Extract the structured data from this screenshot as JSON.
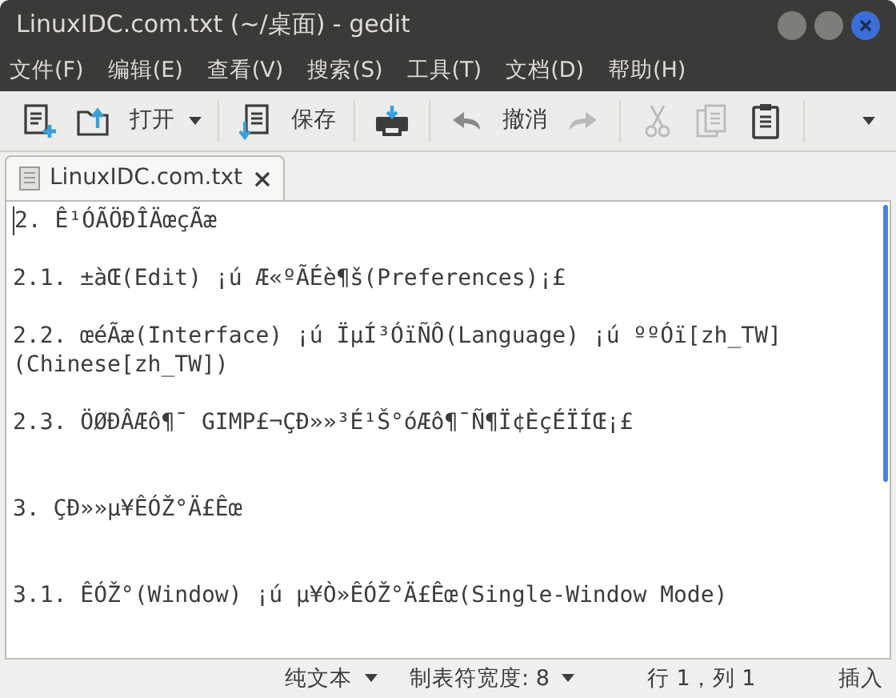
{
  "window": {
    "title": "LinuxIDC.com.txt (~/桌面) - gedit"
  },
  "menu": [
    "文件(F)",
    "编辑(E)",
    "查看(V)",
    "搜索(S)",
    "工具(T)",
    "文档(D)",
    "帮助(H)"
  ],
  "toolbar": [
    {
      "kind": "new"
    },
    {
      "kind": "open",
      "label": "打开"
    },
    {
      "kind": "save",
      "label": "保存"
    },
    {
      "kind": "print"
    },
    {
      "kind": "undo",
      "label": "撤消"
    },
    {
      "kind": "redo",
      "disabled": true
    },
    {
      "kind": "cut",
      "disabled": true
    },
    {
      "kind": "copy",
      "disabled": true
    },
    {
      "kind": "paste"
    },
    {
      "kind": "more"
    }
  ],
  "tabs": [
    {
      "label": "LinuxIDC.com.txt",
      "selected": true
    }
  ],
  "document": {
    "text": "2. Ê¹ÓÃÖÐÎÄœçÃæ\n\n2.1. ±àŒ(Edit) ¡ú Æ«ºÃÉè¶š(Preferences)¡£\n\n2.2. œéÃæ(Interface) ¡ú ÏµÍ³ÓïÑÔ(Language) ¡ú ººÓï[zh_TW] (Chinese[zh_TW])\n\n2.3. ÖØÐÂÆô¶¯ GIMP£¬ÇÐ»»³É¹Š°óÆô¶¯Ñ¶Ï¢ÈçÉÏÍŒ¡£\n\n\n3. ÇÐ»»µ¥ÊÓŽ°Ä£Êœ\n\n\n3.1. ÊÓŽ°(Window) ¡ú µ¥Ò»ÊÓŽ°Ä£Êœ(Single-Window Mode)"
  },
  "status_bar": {
    "language": "纯文本",
    "tab_width": "制表符宽度: 8",
    "position": "行 1，列 1",
    "mode": "插入"
  }
}
